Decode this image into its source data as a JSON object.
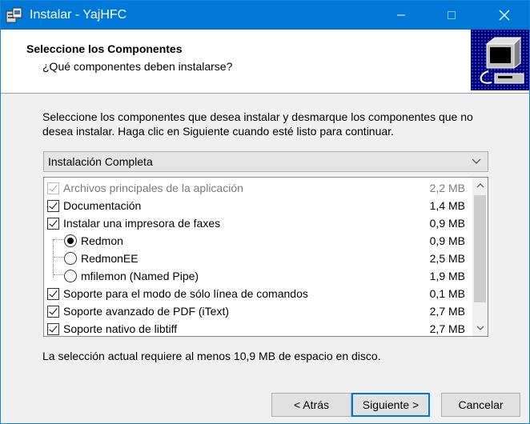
{
  "window": {
    "title": "Instalar - YajHFC"
  },
  "header": {
    "title": "Seleccione los Componentes",
    "subtitle": "¿Qué componentes deben instalarse?"
  },
  "intro_text": "Seleccione los componentes que desea instalar y desmarque los componentes que no desea instalar. Haga clic en Siguiente cuando esté listo para continuar.",
  "install_type": {
    "selected": "Instalación Completa"
  },
  "components": [
    {
      "label": "Archivos principales de la aplicación",
      "size": "2,2 MB",
      "kind": "checkbox",
      "checked": true,
      "disabled": true
    },
    {
      "label": "Documentación",
      "size": "1,4 MB",
      "kind": "checkbox",
      "checked": true,
      "disabled": false
    },
    {
      "label": "Instalar una impresora de faxes",
      "size": "0,9 MB",
      "kind": "checkbox",
      "checked": true,
      "disabled": false
    },
    {
      "label": "Redmon",
      "size": "0,9 MB",
      "kind": "radio",
      "checked": true,
      "disabled": false
    },
    {
      "label": "RedmonEE",
      "size": "2,5 MB",
      "kind": "radio",
      "checked": false,
      "disabled": false
    },
    {
      "label": "mfilemon (Named Pipe)",
      "size": "1,9 MB",
      "kind": "radio",
      "checked": false,
      "disabled": false
    },
    {
      "label": "Soporte para el modo de sólo línea de comandos",
      "size": "0,1 MB",
      "kind": "checkbox",
      "checked": true,
      "disabled": false
    },
    {
      "label": "Soporte avanzado de PDF (iText)",
      "size": "2,7 MB",
      "kind": "checkbox",
      "checked": true,
      "disabled": false
    },
    {
      "label": "Soporte nativo de libtiff",
      "size": "2,7 MB",
      "kind": "checkbox",
      "checked": true,
      "disabled": false
    }
  ],
  "space_required": "La selección actual requiere al menos 10,9 MB de espacio en disco.",
  "buttons": {
    "back": "< Atrás",
    "next": "Siguiente >",
    "cancel": "Cancelar"
  },
  "colors": {
    "titlebar": "#0078d7",
    "header_image_bg": "#00007a"
  }
}
